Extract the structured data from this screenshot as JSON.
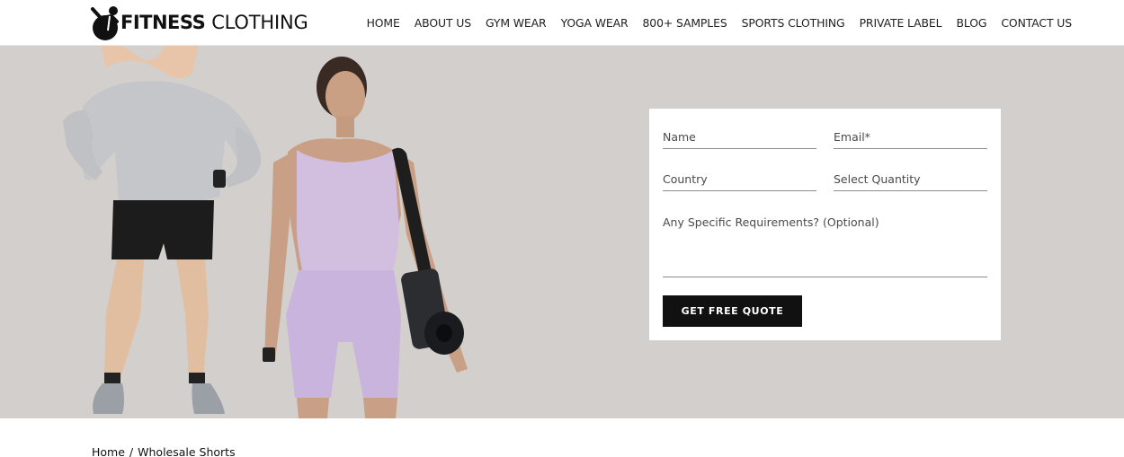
{
  "brand": {
    "name_bold": "FITNESS",
    "name_light": "CLOTHING",
    "logo_icon": "figure-with-ball-icon"
  },
  "nav": {
    "items": [
      "HOME",
      "ABOUT US",
      "GYM WEAR",
      "YOGA WEAR",
      "800+ SAMPLES",
      "SPORTS CLOTHING",
      "PRIVATE LABEL",
      "BLOG",
      "CONTACT US"
    ]
  },
  "hero": {
    "background_color": "#d3cfcc",
    "image": "man-and-woman-in-activewear-with-yoga-mat"
  },
  "quote_form": {
    "name_placeholder": "Name",
    "email_placeholder": "Email*",
    "country_placeholder": "Country",
    "quantity_placeholder": "Select Quantity",
    "requirements_placeholder": "Any Specific Requirements? (Optional)",
    "submit_label": "GET FREE QUOTE"
  },
  "breadcrumb": {
    "home": "Home",
    "separator": "/",
    "current": "Wholesale Shorts"
  }
}
